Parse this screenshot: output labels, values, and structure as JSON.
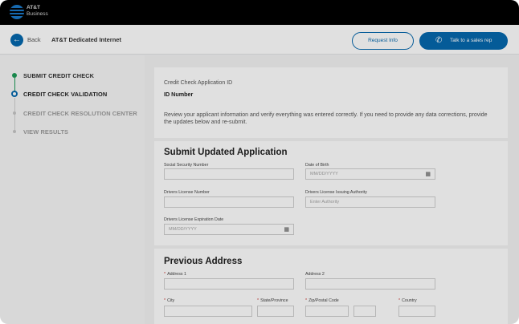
{
  "brand": {
    "name": "AT&T",
    "sub": "Business"
  },
  "header": {
    "back_label": "Back",
    "page_name": "AT&T Dedicated Internet",
    "request_info": "Request Info",
    "talk_to_sales": "Talk to a sales rep"
  },
  "steps": [
    {
      "label": "SUBMIT CREDIT CHECK",
      "state": "done"
    },
    {
      "label": "CREDIT CHECK VALIDATION",
      "state": "active"
    },
    {
      "label": "CREDIT CHECK RESOLUTION CENTER",
      "state": "todo"
    },
    {
      "label": "VIEW RESULTS",
      "state": "todo"
    }
  ],
  "application": {
    "id_label": "Credit Check Application ID",
    "id_value": "ID Number",
    "review_text": "Review your applicant information and verify everything was entered correctly. If you need to provide any data corrections, provide the updates below and re-submit."
  },
  "updated": {
    "title": "Submit Updated Application",
    "ssn_label": "Social Security Number",
    "dob_label": "Date of Birth",
    "dob_placeholder": "MM/DD/YYYY",
    "dl_number_label": "Drivers License Number",
    "dl_authority_label": "Drivers License Issuing Authority",
    "dl_authority_placeholder": "Enter Authority",
    "dl_expiration_label": "Drivers License Expiration Date",
    "dl_expiration_placeholder": "MM/DD/YYYY"
  },
  "previous_address": {
    "title": "Previous Address",
    "address1_label": "Address 1",
    "address2_label": "Address 2",
    "city_label": "City",
    "state_label": "State/Province",
    "zip_label": "Zip/Postal Code",
    "country_label": "Country"
  },
  "colors": {
    "accent": "#0568ae",
    "step_done": "#1d9a57"
  }
}
